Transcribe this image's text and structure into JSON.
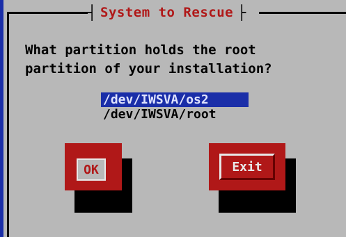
{
  "dialog": {
    "title": "System to Rescue",
    "question_line1": "What partition holds the root",
    "question_line2": "partition of your installation?"
  },
  "partitions": {
    "items": [
      "/dev/IWSVA/os2",
      "/dev/IWSVA/root"
    ],
    "selected_index": 0
  },
  "buttons": {
    "ok_label": "OK",
    "exit_label": "Exit"
  },
  "colors": {
    "background": "#b8b8b8",
    "accent_red": "#b01818",
    "selection_blue": "#1a2ea8"
  }
}
